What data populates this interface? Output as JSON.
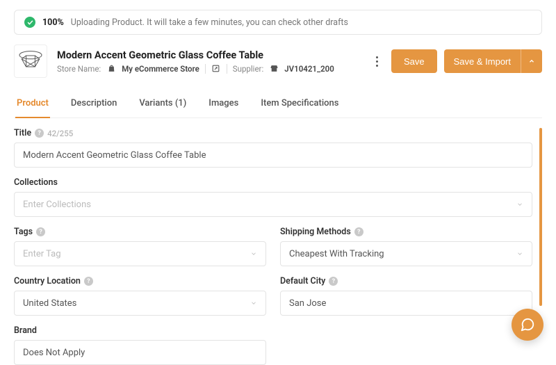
{
  "banner": {
    "percent": "100%",
    "message": "Uploading Product. It will take a few minutes, you can check other drafts"
  },
  "product": {
    "title": "Modern Accent Geometric Glass Coffee Table",
    "store_name_label": "Store Name:",
    "store_name": "My eCommerce Store",
    "supplier_label": "Supplier:",
    "supplier_code": "JV10421_200"
  },
  "actions": {
    "save": "Save",
    "save_import": "Save & Import"
  },
  "tabs": [
    {
      "label": "Product",
      "active": true
    },
    {
      "label": "Description",
      "active": false
    },
    {
      "label": "Variants (1)",
      "active": false
    },
    {
      "label": "Images",
      "active": false
    },
    {
      "label": "Item Specifications",
      "active": false
    }
  ],
  "form": {
    "title_label": "Title",
    "title_count": "42/255",
    "title_value": "Modern Accent Geometric Glass Coffee Table",
    "collections_label": "Collections",
    "collections_placeholder": "Enter Collections",
    "tags_label": "Tags",
    "tags_placeholder": "Enter Tag",
    "shipping_label": "Shipping Methods",
    "shipping_value": "Cheapest With Tracking",
    "country_label": "Country Location",
    "country_value": "United States",
    "city_label": "Default City",
    "city_value": "San Jose",
    "brand_label": "Brand",
    "brand_value": "Does Not Apply"
  }
}
